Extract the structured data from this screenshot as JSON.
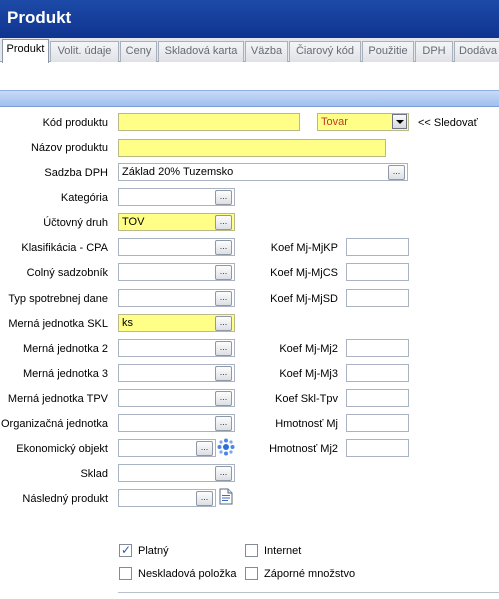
{
  "window": {
    "title": "Produkt"
  },
  "tabs": [
    "Produkt",
    "Volit. údaje",
    "Ceny",
    "Skladová karta",
    "Väzba",
    "Čiarový kód",
    "Použitie",
    "DPH",
    "Dodáva"
  ],
  "form": {
    "kod_produktu": {
      "label": "Kód produktu",
      "value": ""
    },
    "typ": {
      "value": "Tovar"
    },
    "sledovat": "<< Sledovať",
    "nazov_produktu": {
      "label": "Názov produktu",
      "value": ""
    },
    "sadzba_dph": {
      "label": "Sadzba DPH",
      "value": "Základ 20% Tuzemsko"
    },
    "kategoria": {
      "label": "Kategória",
      "value": ""
    },
    "uctovny_druh": {
      "label": "Účtovný druh",
      "value": "TOV"
    },
    "klasifikacia": {
      "label": "Klasifikácia - CPA",
      "value": ""
    },
    "colny": {
      "label": "Colný sadzobník",
      "value": ""
    },
    "typ_spotrebnej": {
      "label": "Typ spotrebnej dane",
      "value": ""
    },
    "mj_skl": {
      "label": "Merná jednotka SKL",
      "value": "ks"
    },
    "mj2": {
      "label": "Merná jednotka 2",
      "value": ""
    },
    "mj3": {
      "label": "Merná jednotka 3",
      "value": ""
    },
    "mj_tpv": {
      "label": "Merná jednotka TPV",
      "value": ""
    },
    "org_jednotka": {
      "label": "Organizačná jednotka",
      "value": ""
    },
    "ekon_objekt": {
      "label": "Ekonomický objekt",
      "value": ""
    },
    "sklad": {
      "label": "Sklad",
      "value": ""
    },
    "nasledny": {
      "label": "Následný produkt",
      "value": ""
    },
    "koef_kp": {
      "label": "Koef Mj-MjKP",
      "value": ""
    },
    "koef_cs": {
      "label": "Koef Mj-MjCS",
      "value": ""
    },
    "koef_sd": {
      "label": "Koef Mj-MjSD",
      "value": ""
    },
    "koef_mj2": {
      "label": "Koef Mj-Mj2",
      "value": ""
    },
    "koef_mj3": {
      "label": "Koef Mj-Mj3",
      "value": ""
    },
    "koef_tpv": {
      "label": "Koef Skl-Tpv",
      "value": ""
    },
    "hmotnost": {
      "label": "Hmotnosť Mj",
      "value": ""
    },
    "hmotnost2": {
      "label": "Hmotnosť Mj2",
      "value": ""
    }
  },
  "browse_label": "...",
  "checkboxes": {
    "platny": {
      "label": "Platný",
      "checked": true
    },
    "internet": {
      "label": "Internet",
      "checked": false
    },
    "neskladova": {
      "label": "Neskladová položka",
      "checked": false
    },
    "zaporne": {
      "label": "Záporné množstvo",
      "checked": false
    }
  }
}
